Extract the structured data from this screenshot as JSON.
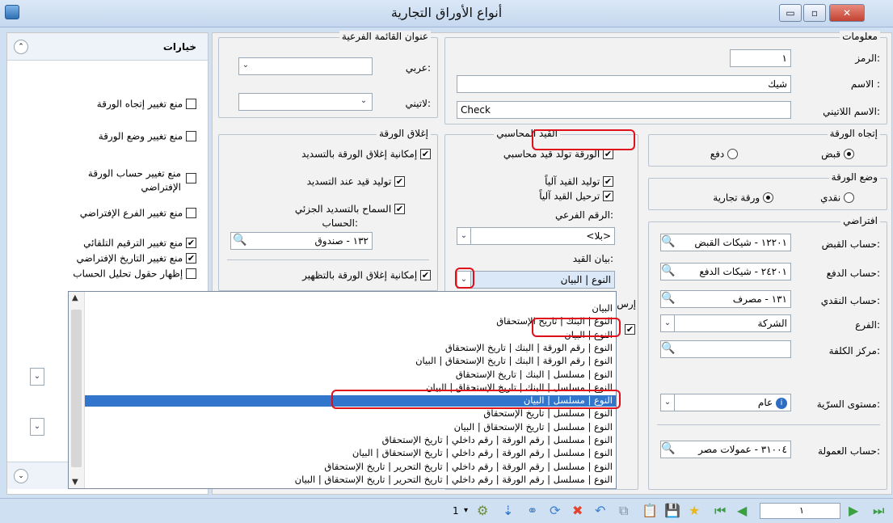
{
  "window": {
    "title": "أنواع الأوراق التجارية",
    "btn_close": "✕",
    "btn_max": "▫",
    "btn_min": "▭"
  },
  "options_panel": {
    "title": "خيارات",
    "collapse": "⌃",
    "expand": "⌄",
    "items": [
      {
        "label": "منع تغيير إتجاه الورقة",
        "checked": false
      },
      {
        "label": "منع تغيير وضع الورقة",
        "checked": false
      },
      {
        "label": "منع تغيير حساب الورقة الإفتراضي",
        "checked": false
      },
      {
        "label": "منع تغيير الفرع الإفتراضي",
        "checked": false
      },
      {
        "label": "منع تغيير الترقيم التلقائي",
        "checked": true
      },
      {
        "label": "منع تغيير التاريخ الإفتراضي",
        "checked": true
      },
      {
        "label": "إظهار حقول تحليل الحساب",
        "checked": false
      }
    ]
  },
  "subtitle_group": {
    "title": "عنوان القائمة الفرعية",
    "arabic_label": "عربي:",
    "latin_label": "لاتيني:"
  },
  "info_group": {
    "title": "معلومات",
    "code_label": "الرمز:",
    "code": "١",
    "name_label": "الاسم :",
    "name": "شيك",
    "latin_name_label": "الاسم اللاتيني:",
    "latin_name": "Check"
  },
  "direction_group": {
    "title": "إتجاه الورقة",
    "receive": "قبض",
    "pay": "دفع"
  },
  "status_group": {
    "title": "وضع الورقة",
    "cash": "نقدي",
    "commercial": "ورقة تجارية"
  },
  "defaults_group": {
    "title": "افتراضي",
    "receive_account_label": "حساب القبض:",
    "receive_account": "١٢٢٠١ - شيكات القبض",
    "pay_account_label": "حساب الدفع:",
    "pay_account": "٢٤٢٠١ - شيكات الدفع",
    "cash_account_label": "حساب النقدي:",
    "cash_account": "١٣١ - مصرف",
    "branch_label": "الفرع:",
    "branch": "الشركة",
    "cost_center_label": "مركز الكلفة:",
    "security_label": "مستوى السرّية:",
    "security": "عام",
    "commission_label": "حساب العمولة:",
    "commission": "٣١٠٠٤ - عمولات مصر"
  },
  "close_group": {
    "title": "إغلاق الورقة",
    "allow_close_payment": "إمكانية إغلاق الورقة بالتسديد",
    "gen_entry_on_pay": "توليد قيد عند التسديد",
    "allow_partial": "السماح بالتسديد الجزئي",
    "account_label": "الحساب:",
    "account": "١٣٢ - صندوق",
    "allow_close_endorse": "إمكانية إغلاق الورقة بالتظهير"
  },
  "entry_group": {
    "title": "القيد المحاسبي",
    "generates_entry": "الورقة تولد قيد محاسبي",
    "auto_generate": "توليد القيد آلياً",
    "auto_post": "ترحيل القيد آلياً",
    "sub_number_label": "الرقم الفرعي:",
    "sub_number": "<بلا>",
    "statement_label": "بيان القيد:",
    "statement": "النوع | البيان",
    "send_partial": "إرس"
  },
  "dropdown_options": [
    "البيان",
    "النوع | البنك | تاريخ الإستحقاق",
    "النوع | البيان",
    "النوع | رقم الورقة | البنك | تاريخ الإستحقاق",
    "النوع | رقم الورقة | البنك | تاريخ الإستحقاق | البيان",
    "النوع | مسلسل | البنك | تاريخ الإستحقاق",
    "النوع | مسلسل | البنك | تاريخ الإستحقاق | البيان",
    "النوع | مسلسل | البيان",
    "النوع | مسلسل | تاريخ الإستحقاق",
    "النوع | مسلسل | تاريخ الإستحقاق | البيان",
    "النوع | مسلسل | رقم الورقة | رقم داخلي | تاريخ الإستحقاق",
    "النوع | مسلسل | رقم الورقة | رقم داخلي | تاريخ الإستحقاق | البيان",
    "النوع | مسلسل | رقم الورقة | رقم داخلي | تاريخ التحرير | تاريخ الإستحقاق",
    "النوع | مسلسل | رقم الورقة | رقم داخلي | تاريخ التحرير | تاريخ الإستحقاق | البيان"
  ],
  "selected_option_index": 7,
  "toolbar": {
    "page": "١",
    "count": "1"
  }
}
